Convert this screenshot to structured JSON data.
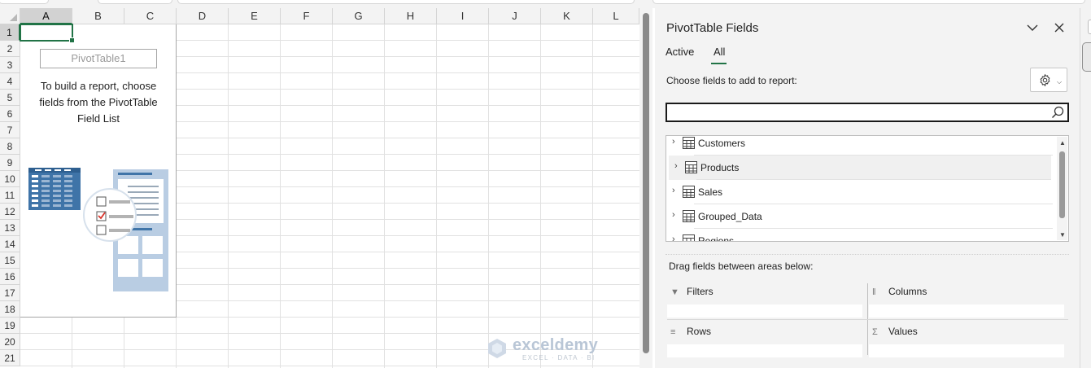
{
  "sheet": {
    "columns": [
      "A",
      "B",
      "C",
      "D",
      "E",
      "F",
      "G",
      "H",
      "I",
      "J",
      "K",
      "L"
    ],
    "rows": [
      "1",
      "2",
      "3",
      "4",
      "5",
      "6",
      "7",
      "8",
      "9",
      "10",
      "11",
      "12",
      "13",
      "14",
      "15",
      "16",
      "17",
      "18",
      "19",
      "20",
      "21"
    ],
    "active_column": "A",
    "active_row": "1"
  },
  "pivot_placeholder": {
    "name": "PivotTable1",
    "message": "To build a report, choose\nfields from the PivotTable\nField List"
  },
  "watermark": {
    "name": "exceldemy",
    "tagline": "EXCEL · DATA · BI"
  },
  "pane": {
    "title": "PivotTable Fields",
    "tabs": [
      "Active",
      "All"
    ],
    "active_tab": "All",
    "choose_label": "Choose fields to add to report:",
    "search_value": "",
    "fields": [
      {
        "label": "Customers",
        "highlighted": false
      },
      {
        "label": "Products",
        "highlighted": true
      },
      {
        "label": "Sales",
        "highlighted": false
      },
      {
        "label": "Grouped_Data",
        "highlighted": false
      },
      {
        "label": "Regions",
        "highlighted": false
      }
    ],
    "drag_label": "Drag fields between areas below:",
    "areas": {
      "filters": "Filters",
      "columns": "Columns",
      "rows": "Rows",
      "values": "Values"
    },
    "icons": {
      "collapse": "chevron-down-icon",
      "close": "close-icon",
      "settings": "gear-icon",
      "search": "search-icon",
      "field_table": "table-icon"
    }
  },
  "colors": {
    "accent": "#217346",
    "pane_bg": "#f3f3f3",
    "pivot_icon_blue": "#3f74a8"
  }
}
